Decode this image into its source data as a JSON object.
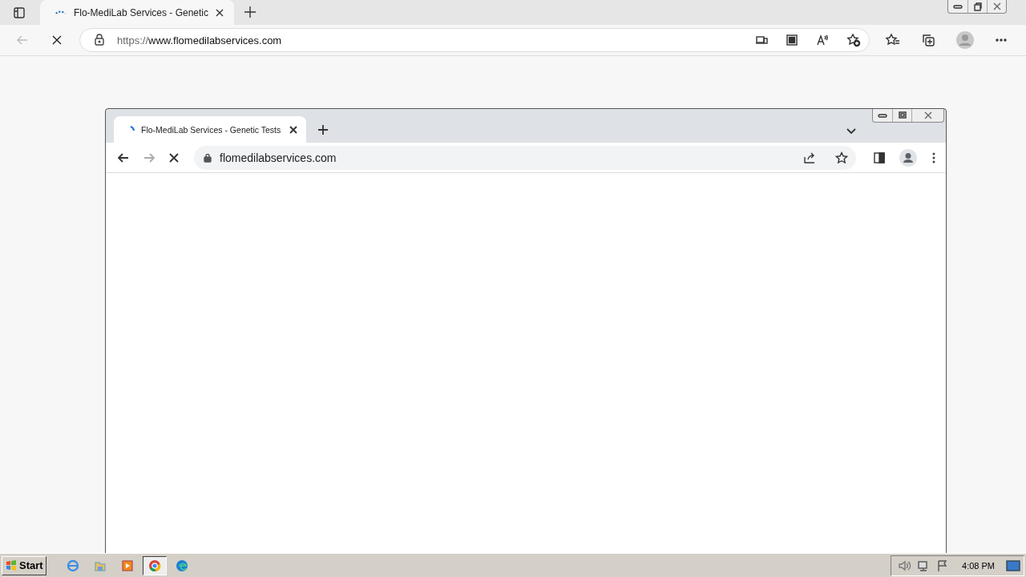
{
  "edge": {
    "tab": {
      "title": "Flo-MediLab Services - Genetic",
      "selected": true
    },
    "address": {
      "scheme": "https://",
      "host": "www.flomedilabservices.com"
    }
  },
  "chrome": {
    "tab": {
      "title": "Flo-MediLab Services - Genetic Tests",
      "selected": true
    },
    "address": {
      "host": "flomedilabservices.com"
    }
  },
  "taskbar": {
    "start": "Start",
    "apps": [
      {
        "kind": "ie",
        "selected": false
      },
      {
        "kind": "folder",
        "selected": false
      },
      {
        "kind": "media",
        "selected": false
      },
      {
        "kind": "chrome",
        "selected": true
      },
      {
        "kind": "edge",
        "selected": false
      }
    ],
    "clock": "4:08 PM"
  }
}
